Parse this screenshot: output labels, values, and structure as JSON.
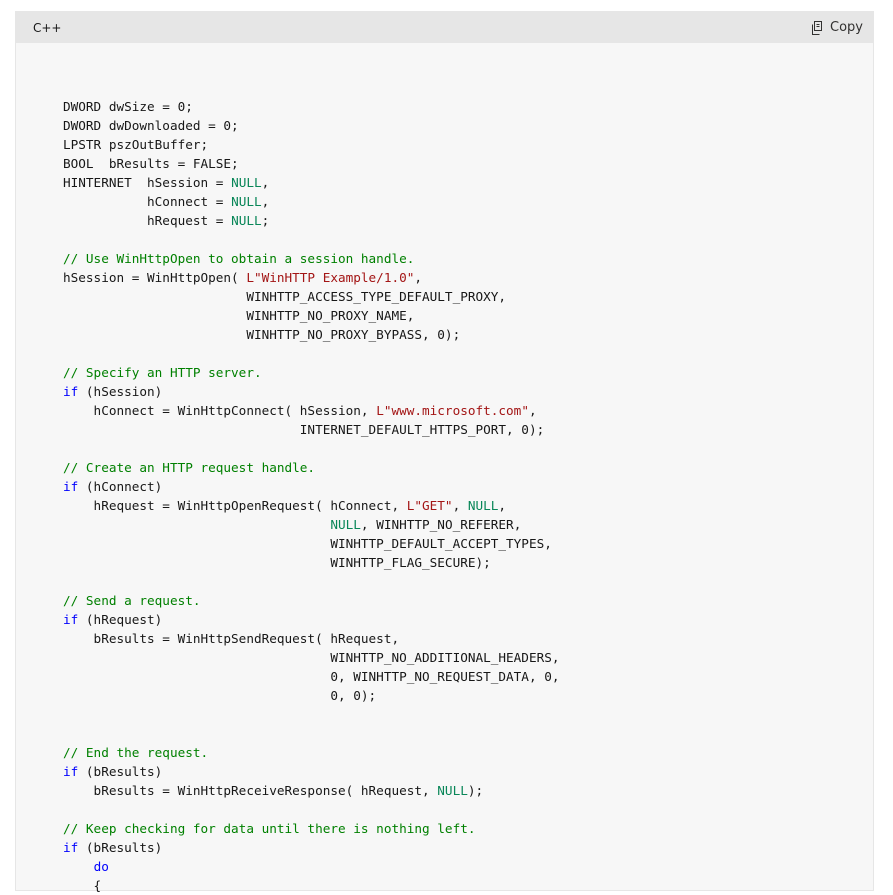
{
  "code_block": {
    "language": "C++",
    "copy_label": "Copy",
    "icon": "copy-icon",
    "colors": {
      "keyword": "#0101fd",
      "string": "#a31515",
      "comment": "#008000",
      "constant": "#098658",
      "text": "#171717",
      "header_bg": "#e6e6e6",
      "body_bg": "#f7f7f7"
    },
    "lines": [
      [],
      [
        [
          "DWORD dwSize = 0;",
          "t"
        ]
      ],
      [
        [
          "DWORD dwDownloaded = 0;",
          "t"
        ]
      ],
      [
        [
          "LPSTR pszOutBuffer;",
          "t"
        ]
      ],
      [
        [
          "BOOL  bResults = FALSE;",
          "t"
        ]
      ],
      [
        [
          "HINTERNET  hSession = ",
          "t"
        ],
        [
          "NULL",
          "cst"
        ],
        [
          ",",
          "t"
        ]
      ],
      [
        [
          "           hConnect = ",
          "t"
        ],
        [
          "NULL",
          "cst"
        ],
        [
          ",",
          "t"
        ]
      ],
      [
        [
          "           hRequest = ",
          "t"
        ],
        [
          "NULL",
          "cst"
        ],
        [
          ";",
          "t"
        ]
      ],
      [],
      [
        [
          "// Use WinHttpOpen to obtain a session handle.",
          "com"
        ]
      ],
      [
        [
          "hSession = WinHttpOpen( ",
          "t"
        ],
        [
          "L\"WinHTTP Example/1.0\"",
          "str"
        ],
        [
          ",",
          "t"
        ]
      ],
      [
        [
          "                        WINHTTP_ACCESS_TYPE_DEFAULT_PROXY,",
          "t"
        ]
      ],
      [
        [
          "                        WINHTTP_NO_PROXY_NAME,",
          "t"
        ]
      ],
      [
        [
          "                        WINHTTP_NO_PROXY_BYPASS, 0);",
          "t"
        ]
      ],
      [],
      [
        [
          "// Specify an HTTP server.",
          "com"
        ]
      ],
      [
        [
          "if",
          "kw"
        ],
        [
          " (hSession)",
          "t"
        ]
      ],
      [
        [
          "    hConnect = WinHttpConnect( hSession, ",
          "t"
        ],
        [
          "L\"www.microsoft.com\"",
          "str"
        ],
        [
          ",",
          "t"
        ]
      ],
      [
        [
          "                               INTERNET_DEFAULT_HTTPS_PORT, 0);",
          "t"
        ]
      ],
      [],
      [
        [
          "// Create an HTTP request handle.",
          "com"
        ]
      ],
      [
        [
          "if",
          "kw"
        ],
        [
          " (hConnect)",
          "t"
        ]
      ],
      [
        [
          "    hRequest = WinHttpOpenRequest( hConnect, ",
          "t"
        ],
        [
          "L\"GET\"",
          "str"
        ],
        [
          ", ",
          "t"
        ],
        [
          "NULL",
          "cst"
        ],
        [
          ",",
          "t"
        ]
      ],
      [
        [
          "                                   ",
          "t"
        ],
        [
          "NULL",
          "cst"
        ],
        [
          ", WINHTTP_NO_REFERER,",
          "t"
        ]
      ],
      [
        [
          "                                   WINHTTP_DEFAULT_ACCEPT_TYPES,",
          "t"
        ]
      ],
      [
        [
          "                                   WINHTTP_FLAG_SECURE);",
          "t"
        ]
      ],
      [],
      [
        [
          "// Send a request.",
          "com"
        ]
      ],
      [
        [
          "if",
          "kw"
        ],
        [
          " (hRequest)",
          "t"
        ]
      ],
      [
        [
          "    bResults = WinHttpSendRequest( hRequest,",
          "t"
        ]
      ],
      [
        [
          "                                   WINHTTP_NO_ADDITIONAL_HEADERS,",
          "t"
        ]
      ],
      [
        [
          "                                   0, WINHTTP_NO_REQUEST_DATA, 0,",
          "t"
        ]
      ],
      [
        [
          "                                   0, 0);",
          "t"
        ]
      ],
      [],
      [],
      [
        [
          "// End the request.",
          "com"
        ]
      ],
      [
        [
          "if",
          "kw"
        ],
        [
          " (bResults)",
          "t"
        ]
      ],
      [
        [
          "    bResults = WinHttpReceiveResponse( hRequest, ",
          "t"
        ],
        [
          "NULL",
          "cst"
        ],
        [
          ");",
          "t"
        ]
      ],
      [],
      [
        [
          "// Keep checking for data until there is nothing left.",
          "com"
        ]
      ],
      [
        [
          "if",
          "kw"
        ],
        [
          " (bResults)",
          "t"
        ]
      ],
      [
        [
          "    ",
          "t"
        ],
        [
          "do",
          "kw"
        ]
      ],
      [
        [
          "    {",
          "t"
        ]
      ]
    ]
  }
}
